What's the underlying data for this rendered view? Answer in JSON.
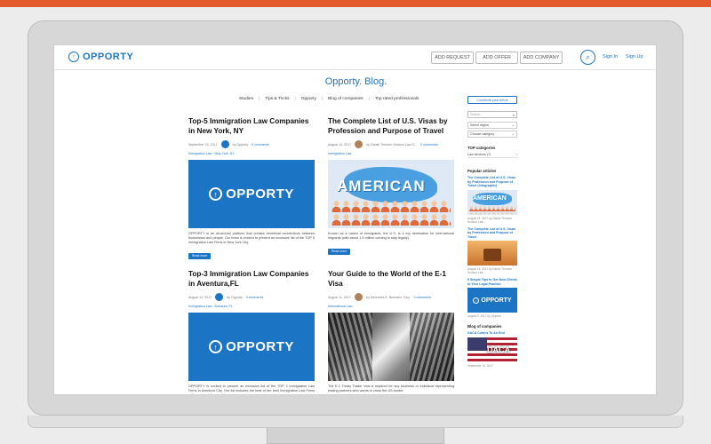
{
  "header": {
    "brand": "OPPORTY",
    "buttons": [
      "ADD REQUEST",
      "ADD OFFER",
      "ADD COMPANY"
    ],
    "links": [
      "Sign In",
      "Sign Up"
    ]
  },
  "blog_title": "Opporty. Blog.",
  "categories": [
    "Studies",
    "Tips & Tricks",
    "Opporty",
    "Blog of companies",
    "Top rated professionals"
  ],
  "posts": [
    {
      "title": "Top-5 Immigration Law Companies in New York, NY",
      "date": "September 14, 2017",
      "author": "by Opporty",
      "comments": "0 comments",
      "tags": "Immigration Law · New York, NY",
      "image_text": "OPPORTY",
      "excerpt": "OPPORTY is an all-around platform that creates beneficial connections between businesses and people. Our team is excited to present an exclusive list of the TOP 5 Immigration Law Firms in New York City.",
      "read_more": "Read more"
    },
    {
      "title": "The Complete List of U.S. Visas by Profession and Purpose of Travel",
      "date": "August 14, 2017",
      "author": "by Daniel Theodor Hudson Law G...",
      "comments": "0 comments",
      "tags": "Immigration Law",
      "image_text": "AMERICAN",
      "excerpt": "Known as a nation of immigrants, the U.S. is a top destination for international migrants (with about 1.5 million coming to stay legally).",
      "read_more": "Read more"
    },
    {
      "title": "Top-3 Immigration Law Companies in Aventura,FL",
      "date": "August 12, 2017",
      "author": "by Opporty",
      "comments": "0 comments",
      "tags": "Immigration Law · Aventura, FL",
      "image_text": "OPPORTY",
      "excerpt": "OPPORTY is excited to present an exclusive list of the TOP 3 Immigration Law Firms in Aventura City. The list includes the best of the best Immigration Law Firms with successfully practicing",
      "read_more": ""
    },
    {
      "title": "Your Guide to the World of the E-1 Visa",
      "date": "August 11, 2017",
      "author": "by Mercedes A. Bermann, Esq.",
      "comments": "0 comments",
      "tags": "International Law",
      "image_text": "",
      "excerpt": "The E-1 Treaty Trader visa is required for any business or individual representing trading partners who wants to cross the US border.",
      "read_more": ""
    }
  ],
  "sidebar": {
    "contribute": "Contribute your Article",
    "search_placeholder": "Search",
    "region": "Select region",
    "category": "Choose category",
    "top_categories_heading": "TOP categories",
    "top_category": "Law services (7)",
    "popular_heading": "Popular articles",
    "popular": [
      {
        "title": "The Complete List of U.S. Visas by Profession and Purpose of Travel (Infographic)",
        "meta": "August 14, 2017 by Daniel Theodor Hudson Law ..."
      },
      {
        "title": "The Complete List of U.S. Visas by Profession and Purpose of Travel",
        "meta": "August 14, 2017 by Daniel Theodor Hudson Law ..."
      },
      {
        "title": "5 Simple Tips to Get New Clients to Your Legal Practice",
        "meta": "August 3, 2017 by Opporty"
      }
    ],
    "blog_companies_heading": "Blog of companies",
    "blog_company": "DACA Comes To An End",
    "blog_company_date": "September 14, 2017",
    "daca_text": "DACA"
  }
}
